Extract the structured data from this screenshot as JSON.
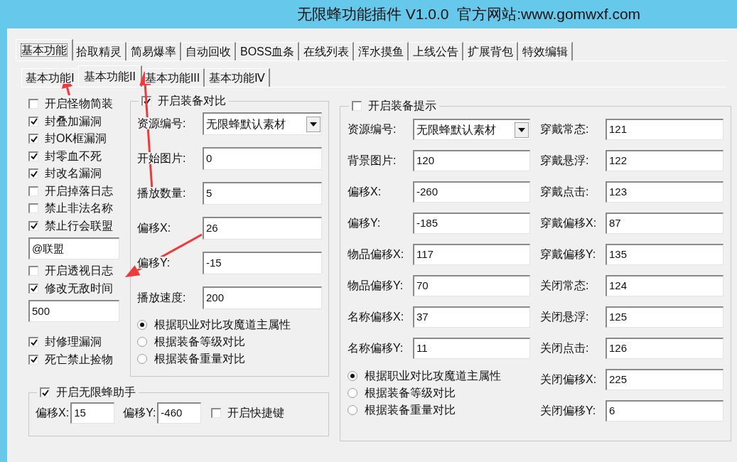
{
  "window": {
    "title": "无限蜂功能插件 V1.0.0  官方网站:www.gomwxf.com"
  },
  "tabs": [
    {
      "label": "基本功能",
      "selected": true
    },
    {
      "label": "拾取精灵",
      "selected": false
    },
    {
      "label": "简易爆率",
      "selected": false
    },
    {
      "label": "自动回收",
      "selected": false
    },
    {
      "label": "BOSS血条",
      "selected": false
    },
    {
      "label": "在线列表",
      "selected": false
    },
    {
      "label": "浑水摸鱼",
      "selected": false
    },
    {
      "label": "上线公告",
      "selected": false
    },
    {
      "label": "扩展背包",
      "selected": false
    },
    {
      "label": "特效编辑",
      "selected": false
    }
  ],
  "subtabs": [
    {
      "label": "基本功能Ⅰ",
      "selected": false
    },
    {
      "label": "基本功能II",
      "selected": true
    },
    {
      "label": "基本功能III",
      "selected": false
    },
    {
      "label": "基本功能Ⅳ",
      "selected": false
    }
  ],
  "options": [
    {
      "kind": "checkbox",
      "label": "开启怪物简装",
      "checked": false
    },
    {
      "kind": "checkbox",
      "label": "封叠加漏洞",
      "checked": true
    },
    {
      "kind": "checkbox",
      "label": "封OK框漏洞",
      "checked": true
    },
    {
      "kind": "checkbox",
      "label": "封零血不死",
      "checked": true
    },
    {
      "kind": "checkbox",
      "label": "封改名漏洞",
      "checked": true
    },
    {
      "kind": "checkbox",
      "label": "开启掉落日志",
      "checked": false
    },
    {
      "kind": "checkbox",
      "label": "禁止非法名称",
      "checked": false
    },
    {
      "kind": "checkbox",
      "label": "禁止行会联盟",
      "checked": true
    },
    {
      "kind": "input",
      "value": "@联盟"
    },
    {
      "kind": "checkbox",
      "label": "开启透视日志",
      "checked": false
    },
    {
      "kind": "checkbox",
      "label": "修改无敌时间",
      "checked": true
    },
    {
      "kind": "input",
      "value": "500"
    },
    {
      "kind": "checkbox",
      "label": "封修理漏洞",
      "checked": true
    },
    {
      "kind": "checkbox",
      "label": "死亡禁止捡物",
      "checked": true
    }
  ],
  "compare_group": {
    "label": "开启装备对比",
    "checked": true,
    "fields": [
      {
        "kind": "select",
        "label": "资源编号:",
        "value": "无限蜂默认素材"
      },
      {
        "kind": "input",
        "label": "开始图片:",
        "value": "0"
      },
      {
        "kind": "input",
        "label": "播放数量:",
        "value": "5"
      },
      {
        "kind": "input",
        "label": "偏移X:",
        "value": "26"
      },
      {
        "kind": "input",
        "label": "偏移Y:",
        "value": "-15"
      },
      {
        "kind": "input",
        "label": "播放速度:",
        "value": "200"
      }
    ],
    "radios": [
      {
        "label": "根据职业对比攻魔道主属性",
        "selected": true
      },
      {
        "label": "根据装备等级对比",
        "selected": false
      },
      {
        "label": "根据装备重量对比",
        "selected": false
      }
    ]
  },
  "helper_group": {
    "label": "开启无限蜂助手",
    "checked": true,
    "fields": [
      {
        "label": "偏移X:",
        "value": "15"
      },
      {
        "label": "偏移Y:",
        "value": "-460"
      }
    ],
    "hotkey": {
      "label": "开启快捷键",
      "checked": false
    }
  },
  "tip_group": {
    "label": "开启装备提示",
    "checked": false,
    "left_fields": [
      {
        "kind": "select",
        "label": "资源编号:",
        "value": "无限蜂默认素材"
      },
      {
        "kind": "input",
        "label": "背景图片:",
        "value": "120"
      },
      {
        "kind": "input",
        "label": "偏移X:",
        "value": "-260"
      },
      {
        "kind": "input",
        "label": "偏移Y:",
        "value": "-185"
      },
      {
        "kind": "input",
        "label": "物品偏移X:",
        "value": "117"
      },
      {
        "kind": "input",
        "label": "物品偏移Y:",
        "value": "70"
      },
      {
        "kind": "input",
        "label": "名称偏移X:",
        "value": "37"
      },
      {
        "kind": "input",
        "label": "名称偏移Y:",
        "value": "11"
      }
    ],
    "radios": [
      {
        "label": "根据职业对比攻魔道主属性",
        "selected": true
      },
      {
        "label": "根据装备等级对比",
        "selected": false
      },
      {
        "label": "根据装备重量对比",
        "selected": false
      }
    ],
    "right_fields": [
      {
        "kind": "input",
        "label": "穿戴常态:",
        "value": "121"
      },
      {
        "kind": "input",
        "label": "穿戴悬浮:",
        "value": "122"
      },
      {
        "kind": "input",
        "label": "穿戴点击:",
        "value": "123"
      },
      {
        "kind": "input",
        "label": "穿戴偏移X:",
        "value": "87"
      },
      {
        "kind": "input",
        "label": "穿戴偏移Y:",
        "value": "135"
      },
      {
        "kind": "input",
        "label": "关闭常态:",
        "value": "124"
      },
      {
        "kind": "input",
        "label": "关闭悬浮:",
        "value": "125"
      },
      {
        "kind": "input",
        "label": "关闭点击:",
        "value": "126"
      },
      {
        "kind": "input",
        "label": "关闭偏移X:",
        "value": "225"
      },
      {
        "kind": "input",
        "label": "关闭偏移Y:",
        "value": "6"
      }
    ]
  }
}
